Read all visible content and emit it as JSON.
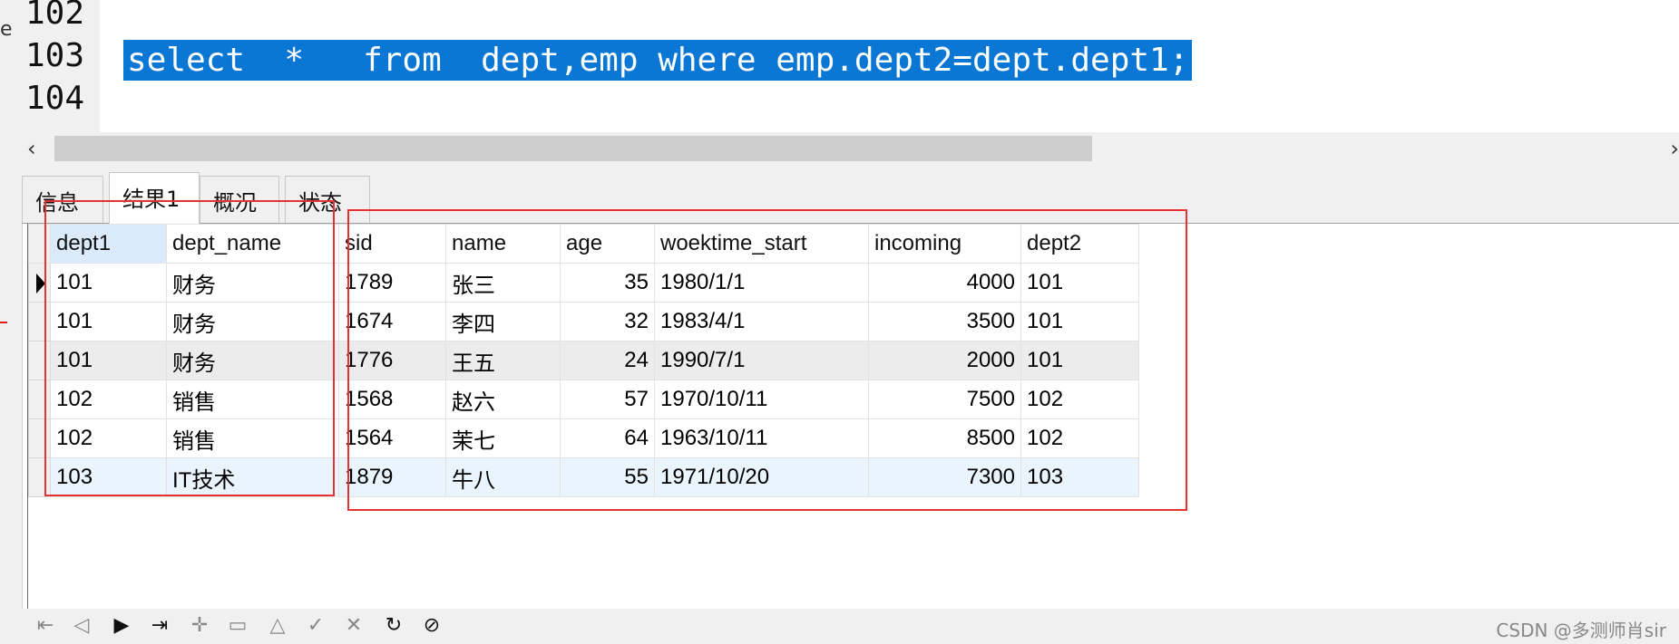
{
  "editor": {
    "lines": [
      {
        "no": "102",
        "code": ""
      },
      {
        "no": "103",
        "code": "select  *   from  dept,emp where emp.dept2=dept.dept1;"
      },
      {
        "no": "104",
        "code": ""
      }
    ]
  },
  "tabs": [
    "信息",
    "结果1",
    "概况",
    "状态"
  ],
  "active_tab": "结果1",
  "grid": {
    "columns": [
      "dept1",
      "dept_name",
      "sid",
      "name",
      "age",
      "woektime_start",
      "incoming",
      "dept2"
    ],
    "rows": [
      [
        "101",
        "财务",
        "1789",
        "张三",
        "35",
        "1980/1/1",
        "4000",
        "101"
      ],
      [
        "101",
        "财务",
        "1674",
        "李四",
        "32",
        "1983/4/1",
        "3500",
        "101"
      ],
      [
        "101",
        "财务",
        "1776",
        "王五",
        "24",
        "1990/7/1",
        "2000",
        "101"
      ],
      [
        "102",
        "销售",
        "1568",
        "赵六",
        "57",
        "1970/10/11",
        "7500",
        "102"
      ],
      [
        "102",
        "销售",
        "1564",
        "茉七",
        "64",
        "1963/10/11",
        "8500",
        "102"
      ],
      [
        "103",
        "IT技术",
        "1879",
        "牛八",
        "55",
        "1971/10/20",
        "7300",
        "103"
      ]
    ]
  },
  "navbar": {
    "icons": [
      "first-record-icon",
      "previous-record-icon",
      "next-record-icon",
      "last-record-icon",
      "add-record-icon",
      "delete-record-icon",
      "edit-record-icon",
      "apply-icon",
      "cancel-icon",
      "refresh-icon",
      "stop-icon"
    ]
  },
  "watermark": "CSDN @多测师肖sir",
  "colors": {
    "selection": "#0a77d5",
    "annotation": "#e53333"
  }
}
